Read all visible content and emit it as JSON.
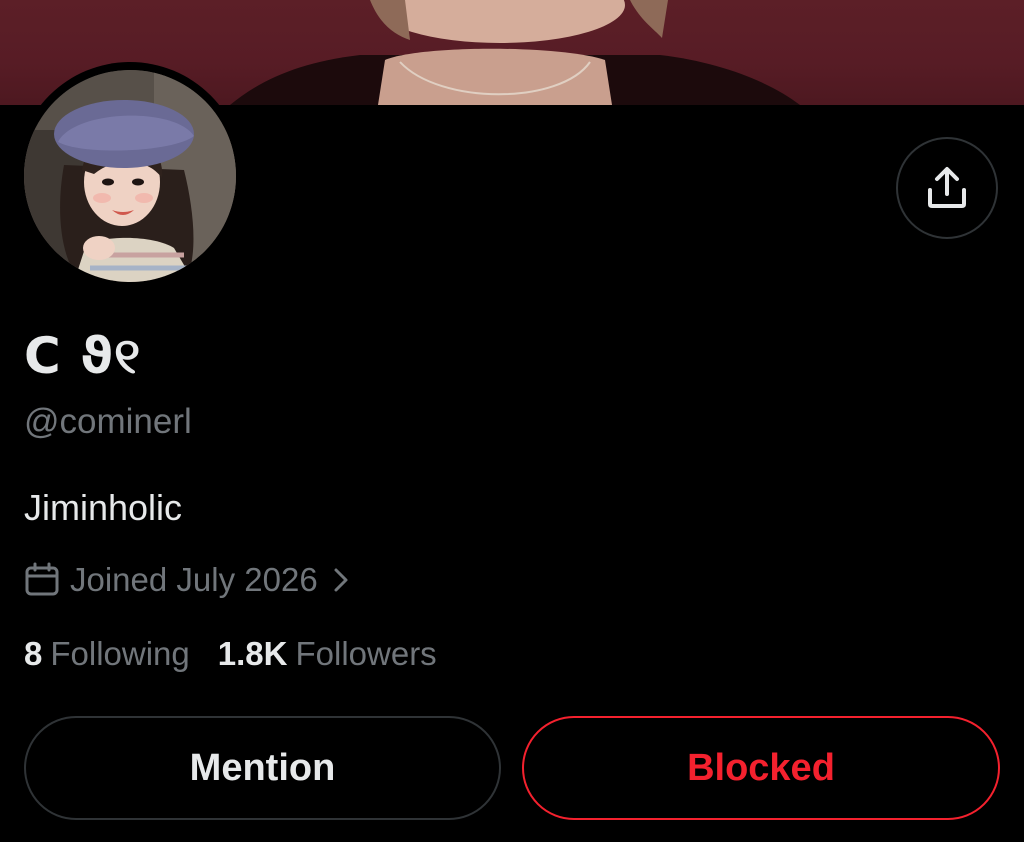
{
  "profile": {
    "display_name": "C ϑ୧",
    "handle": "@cominerl",
    "bio": "Jiminholic",
    "joined": "Joined July 2026"
  },
  "stats": {
    "following_count": "8",
    "following_label": "Following",
    "followers_count": "1.8K",
    "followers_label": "Followers"
  },
  "actions": {
    "mention_label": "Mention",
    "blocked_label": "Blocked"
  },
  "icons": {
    "share": "share-upload-icon",
    "calendar": "calendar-icon",
    "chevron": "chevron-right-icon"
  },
  "colors": {
    "background": "#000000",
    "banner": "#571c25",
    "text_primary": "#e7e9ea",
    "text_secondary": "#71767b",
    "border": "#2f3336",
    "blocked_red": "#f4212e"
  }
}
